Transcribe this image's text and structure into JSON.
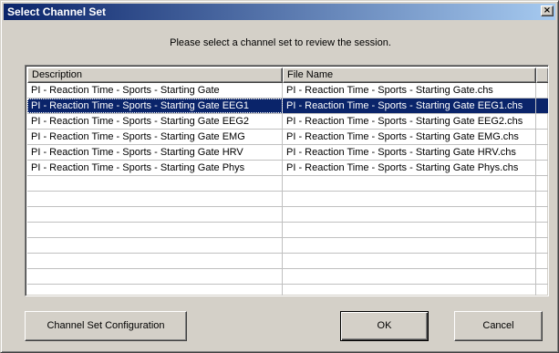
{
  "window": {
    "title": "Select Channel Set",
    "close_glyph": "×"
  },
  "prompt": "Please select a channel set to review the session.",
  "list": {
    "columns": [
      "Description",
      "File Name",
      ""
    ],
    "selected_index": 1,
    "rows": [
      {
        "description": "PI - Reaction Time - Sports - Starting Gate",
        "file": "PI - Reaction Time - Sports - Starting Gate.chs"
      },
      {
        "description": "PI - Reaction Time - Sports - Starting Gate EEG1",
        "file": "PI - Reaction Time - Sports - Starting Gate EEG1.chs"
      },
      {
        "description": "PI - Reaction Time - Sports - Starting Gate EEG2",
        "file": "PI - Reaction Time - Sports - Starting Gate EEG2.chs"
      },
      {
        "description": "PI - Reaction Time - Sports - Starting Gate EMG",
        "file": "PI - Reaction Time - Sports - Starting Gate EMG.chs"
      },
      {
        "description": "PI - Reaction Time - Sports - Starting Gate HRV",
        "file": "PI - Reaction Time - Sports - Starting Gate HRV.chs"
      },
      {
        "description": "PI - Reaction Time - Sports - Starting Gate Phys",
        "file": "PI - Reaction Time - Sports - Starting Gate Phys.chs"
      }
    ]
  },
  "buttons": {
    "channel_set_config": "Channel Set Configuration",
    "ok": "OK",
    "cancel": "Cancel"
  },
  "colors": {
    "face": "#d4d0c8",
    "selection": "#0a246a",
    "title_gradient_end": "#a6caf0"
  }
}
